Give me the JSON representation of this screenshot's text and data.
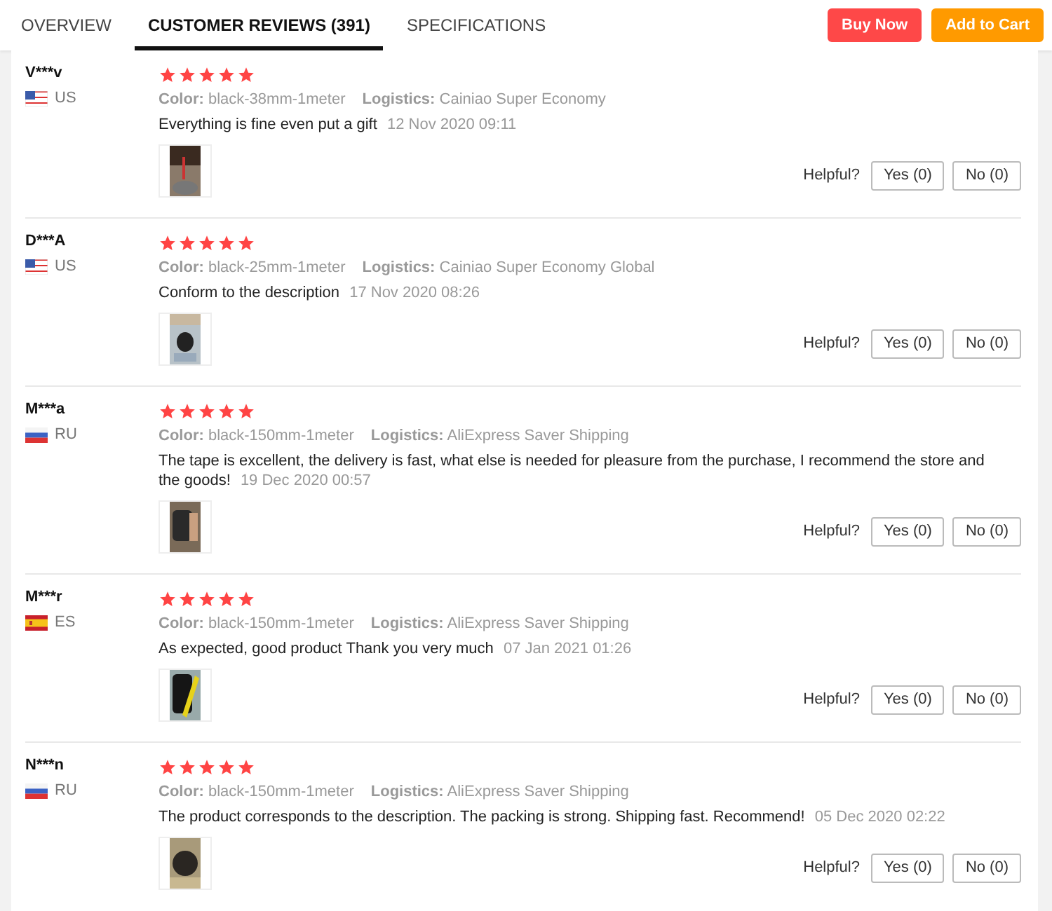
{
  "tabs": [
    {
      "label": "OVERVIEW",
      "selected": false
    },
    {
      "label": "CUSTOMER REVIEWS (391)",
      "selected": true
    },
    {
      "label": "SPECIFICATIONS",
      "selected": false
    }
  ],
  "actions": [
    {
      "label": "Buy Now",
      "kind": "buy"
    },
    {
      "label": "Add to Cart",
      "kind": "cart"
    }
  ],
  "reviews": [
    {
      "name": "V***v",
      "flag": {
        "kind": "us"
      },
      "country": "US",
      "stars": 5,
      "color_label": "Color:",
      "variant": "black-38mm-1meter",
      "logistics_label": "Logistics:",
      "logistics": "Cainiao Super Economy",
      "comment": "Everything is fine even put a gift",
      "date": "12 Nov 2020 09:11",
      "helpful": "Helpful?",
      "yes": "Yes (0)",
      "no": "No (0)"
    },
    {
      "name": "D***A",
      "flag": {
        "kind": "us"
      },
      "country": "US",
      "stars": 5,
      "color_label": "Color:",
      "variant": "black-25mm-1meter",
      "logistics_label": "Logistics:",
      "logistics": "Cainiao Super Economy Global",
      "comment": "Conform to the description",
      "date": "17 Nov 2020 08:26",
      "helpful": "Helpful?",
      "yes": "Yes (0)",
      "no": "No (0)"
    },
    {
      "name": "M***a",
      "flag": {
        "kind": "ru"
      },
      "country": "RU",
      "stars": 5,
      "color_label": "Color:",
      "variant": "black-150mm-1meter",
      "logistics_label": "Logistics:",
      "logistics": "AliExpress Saver Shipping",
      "comment": "The tape is excellent, the delivery is fast, what else is needed for pleasure from the purchase, I recommend the store and the goods!",
      "date": "19 Dec 2020 00:57",
      "helpful": "Helpful?",
      "yes": "Yes (0)",
      "no": "No (0)"
    },
    {
      "name": "M***r",
      "flag": {
        "kind": "es"
      },
      "country": "ES",
      "stars": 5,
      "color_label": "Color:",
      "variant": "black-150mm-1meter",
      "logistics_label": "Logistics:",
      "logistics": "AliExpress Saver Shipping",
      "comment": "As expected, good product Thank you very much",
      "date": "07 Jan 2021 01:26",
      "helpful": "Helpful?",
      "yes": "Yes (0)",
      "no": "No (0)"
    },
    {
      "name": "N***n",
      "flag": {
        "kind": "ru"
      },
      "country": "RU",
      "stars": 5,
      "color_label": "Color:",
      "variant": "black-150mm-1meter",
      "logistics_label": "Logistics:",
      "logistics": "AliExpress Saver Shipping",
      "comment": "The product corresponds to the description. The packing is strong. Shipping fast. Recommend!",
      "date": "05 Dec 2020 02:22",
      "helpful": "Helpful?",
      "yes": "Yes (0)",
      "no": "No (0)"
    }
  ]
}
